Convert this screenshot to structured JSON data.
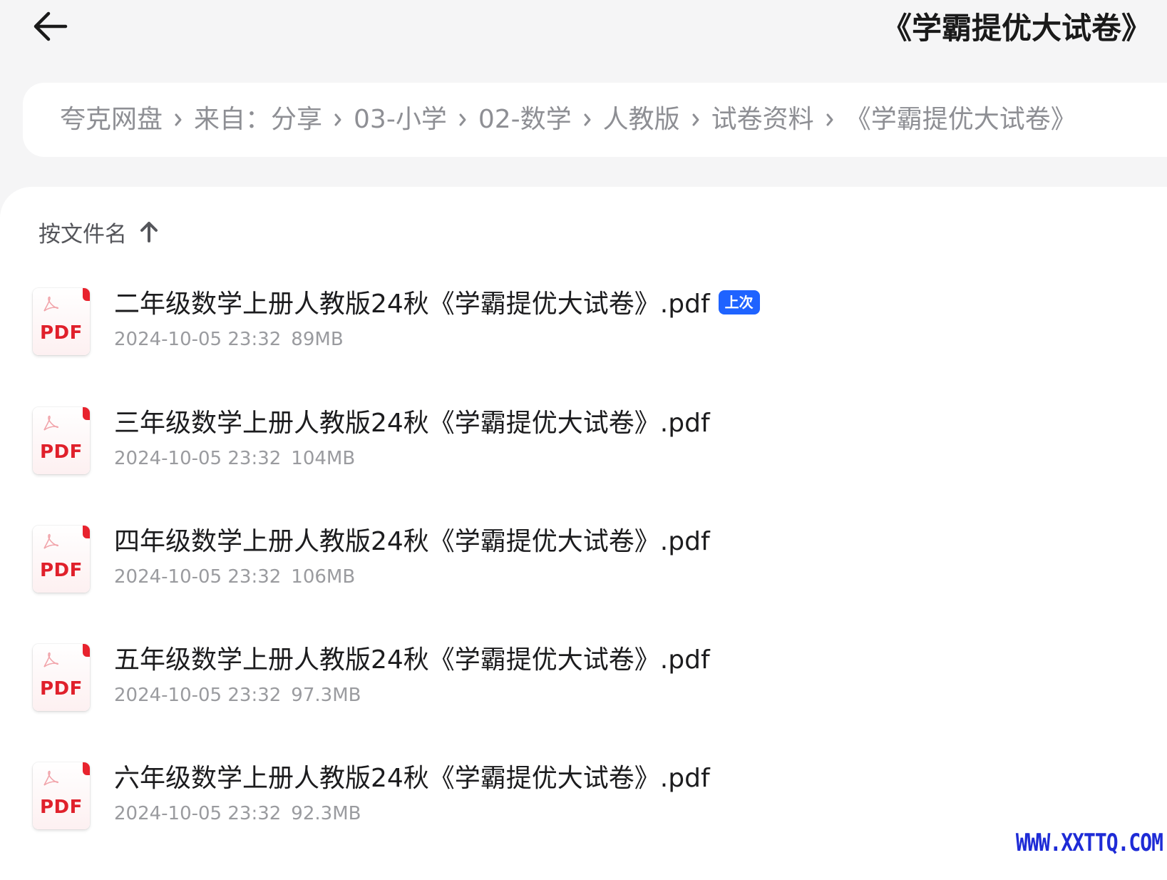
{
  "header": {
    "title": "《学霸提优大试卷》"
  },
  "breadcrumb": [
    {
      "label": "夸克网盘"
    },
    {
      "label": "来自：分享"
    },
    {
      "label": "03-小学"
    },
    {
      "label": "02-数学"
    },
    {
      "label": "人教版"
    },
    {
      "label": "试卷资料"
    },
    {
      "label": "《学霸提优大试卷》"
    }
  ],
  "sort": {
    "label": "按文件名",
    "direction": "ascending"
  },
  "files": [
    {
      "name": "二年级数学上册人教版24秋《学霸提优大试卷》.pdf",
      "date": "2024-10-05 23:32",
      "size": "89MB",
      "badge": "上次",
      "icon_text": "PDF"
    },
    {
      "name": "三年级数学上册人教版24秋《学霸提优大试卷》.pdf",
      "date": "2024-10-05 23:32",
      "size": "104MB",
      "icon_text": "PDF"
    },
    {
      "name": "四年级数学上册人教版24秋《学霸提优大试卷》.pdf",
      "date": "2024-10-05 23:32",
      "size": "106MB",
      "icon_text": "PDF"
    },
    {
      "name": "五年级数学上册人教版24秋《学霸提优大试卷》.pdf",
      "date": "2024-10-05 23:32",
      "size": "97.3MB",
      "icon_text": "PDF"
    },
    {
      "name": "六年级数学上册人教版24秋《学霸提优大试卷》.pdf",
      "date": "2024-10-05 23:32",
      "size": "92.3MB",
      "icon_text": "PDF"
    }
  ],
  "watermark": "WWW.XXTTQ.COM",
  "colors": {
    "background": "#f5f5f6",
    "badge": "#1f63ff",
    "pdf_red": "#e0202b",
    "watermark": "#1e2bd6"
  },
  "icons": {
    "back": "arrow-left-icon",
    "breadcrumb_separator": "chevron-right-icon",
    "sort": "arrow-up-icon",
    "file": "pdf-file-icon"
  }
}
